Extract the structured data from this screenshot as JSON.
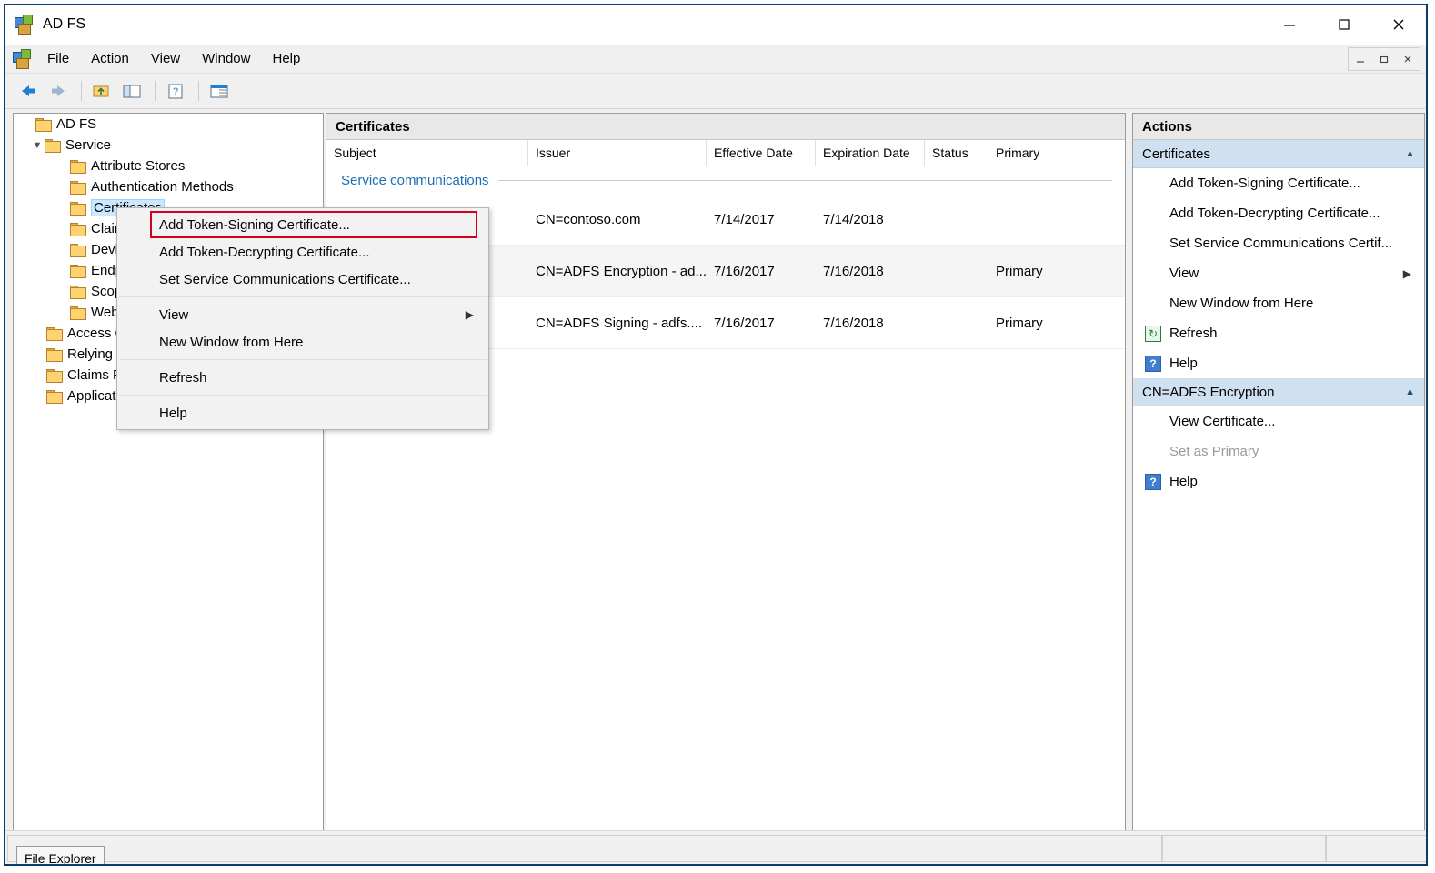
{
  "window": {
    "title": "AD FS",
    "icon": "adfs-icon",
    "buttons": {
      "minimize": "minimize-icon",
      "maximize": "maximize-icon",
      "close": "close-icon"
    }
  },
  "menubar": {
    "items": [
      "File",
      "Action",
      "View",
      "Window",
      "Help"
    ],
    "mdi": [
      "_",
      "▣",
      "✕"
    ]
  },
  "toolbar": {
    "buttons": [
      "back-icon",
      "forward-icon",
      "up-folder-icon",
      "show-hide-tree-icon",
      "help-icon",
      "properties-icon"
    ]
  },
  "tree": {
    "root": "AD FS",
    "items": [
      {
        "label": "Service",
        "level": 1,
        "expanded": true,
        "selected": false
      },
      {
        "label": "Attribute Stores",
        "level": 2,
        "expanded": false,
        "selected": false
      },
      {
        "label": "Authentication Methods",
        "level": 2,
        "expanded": false,
        "selected": false
      },
      {
        "label": "Certificates",
        "level": 2,
        "expanded": false,
        "selected": true
      },
      {
        "label": "Claim Descriptions",
        "level": 2,
        "expanded": false,
        "selected": false
      },
      {
        "label": "Device Registration",
        "level": 2,
        "expanded": false,
        "selected": false
      },
      {
        "label": "Endpoints",
        "level": 2,
        "expanded": false,
        "selected": false
      },
      {
        "label": "Scope Descriptions",
        "level": 2,
        "expanded": false,
        "selected": false
      },
      {
        "label": "Web Application Proxy",
        "level": 2,
        "expanded": false,
        "selected": false
      },
      {
        "label": "Access Control Policies",
        "level": 1,
        "expanded": false,
        "selected": false
      },
      {
        "label": "Relying Party Trusts",
        "level": 1,
        "expanded": false,
        "selected": false
      },
      {
        "label": "Claims Provider Trusts",
        "level": 1,
        "expanded": false,
        "selected": false
      },
      {
        "label": "Application Groups",
        "level": 1,
        "expanded": false,
        "selected": false
      }
    ]
  },
  "list": {
    "title": "Certificates",
    "columns": [
      "Subject",
      "Issuer",
      "Effective Date",
      "Expiration Date",
      "Status",
      "Primary"
    ],
    "group": "Service communications",
    "rows": [
      {
        "icon": "certificate-icon",
        "subject": "",
        "issuer": "CN=contoso.com",
        "effective": "7/14/2017",
        "expiration": "7/14/2018",
        "status": "",
        "primary": ""
      },
      {
        "icon": "certificate-icon",
        "subject": "",
        "issuer": "CN=ADFS Encryption - ad...",
        "effective": "7/16/2017",
        "expiration": "7/16/2018",
        "status": "",
        "primary": "Primary"
      },
      {
        "icon": "certificate-icon",
        "subject": "",
        "issuer": "CN=ADFS Signing - adfs....",
        "effective": "7/16/2017",
        "expiration": "7/16/2018",
        "status": "",
        "primary": "Primary"
      }
    ]
  },
  "context_menu": {
    "items": [
      {
        "label": "Add Token-Signing Certificate...",
        "highlighted": true,
        "submenu": false
      },
      {
        "label": "Add Token-Decrypting Certificate...",
        "highlighted": false,
        "submenu": false
      },
      {
        "label": "Set Service Communications Certificate...",
        "highlighted": false,
        "submenu": false
      },
      {
        "label": "View",
        "highlighted": false,
        "submenu": true
      },
      {
        "label": "New Window from Here",
        "highlighted": false,
        "submenu": false
      },
      {
        "label": "Refresh",
        "highlighted": false,
        "submenu": false
      },
      {
        "label": "Help",
        "highlighted": false,
        "submenu": false
      }
    ]
  },
  "actions": {
    "title": "Actions",
    "sections": [
      {
        "header": "Certificates",
        "items": [
          {
            "label": "Add Token-Signing Certificate...",
            "icon": "",
            "disabled": false,
            "submenu": false
          },
          {
            "label": "Add Token-Decrypting Certificate...",
            "icon": "",
            "disabled": false,
            "submenu": false
          },
          {
            "label": "Set Service Communications Certif...",
            "icon": "",
            "disabled": false,
            "submenu": false
          },
          {
            "label": "View",
            "icon": "",
            "disabled": false,
            "submenu": true
          },
          {
            "label": "New Window from Here",
            "icon": "",
            "disabled": false,
            "submenu": false
          },
          {
            "label": "Refresh",
            "icon": "refresh-icon",
            "disabled": false,
            "submenu": false
          },
          {
            "label": "Help",
            "icon": "help-icon",
            "disabled": false,
            "submenu": false
          }
        ]
      },
      {
        "header": "CN=ADFS Encryption",
        "items": [
          {
            "label": "View Certificate...",
            "icon": "",
            "disabled": false,
            "submenu": false
          },
          {
            "label": "Set as Primary",
            "icon": "",
            "disabled": true,
            "submenu": false
          },
          {
            "label": "Help",
            "icon": "help-icon",
            "disabled": false,
            "submenu": false
          }
        ]
      }
    ]
  },
  "statusbar": {
    "taskbar_button": "File Explorer"
  },
  "colors": {
    "accent": "#cfe0f0",
    "highlight_border": "#d0021b",
    "group_text": "#1a6fb5",
    "selection": "#cce8ff",
    "window_border": "#0a3d6e"
  }
}
